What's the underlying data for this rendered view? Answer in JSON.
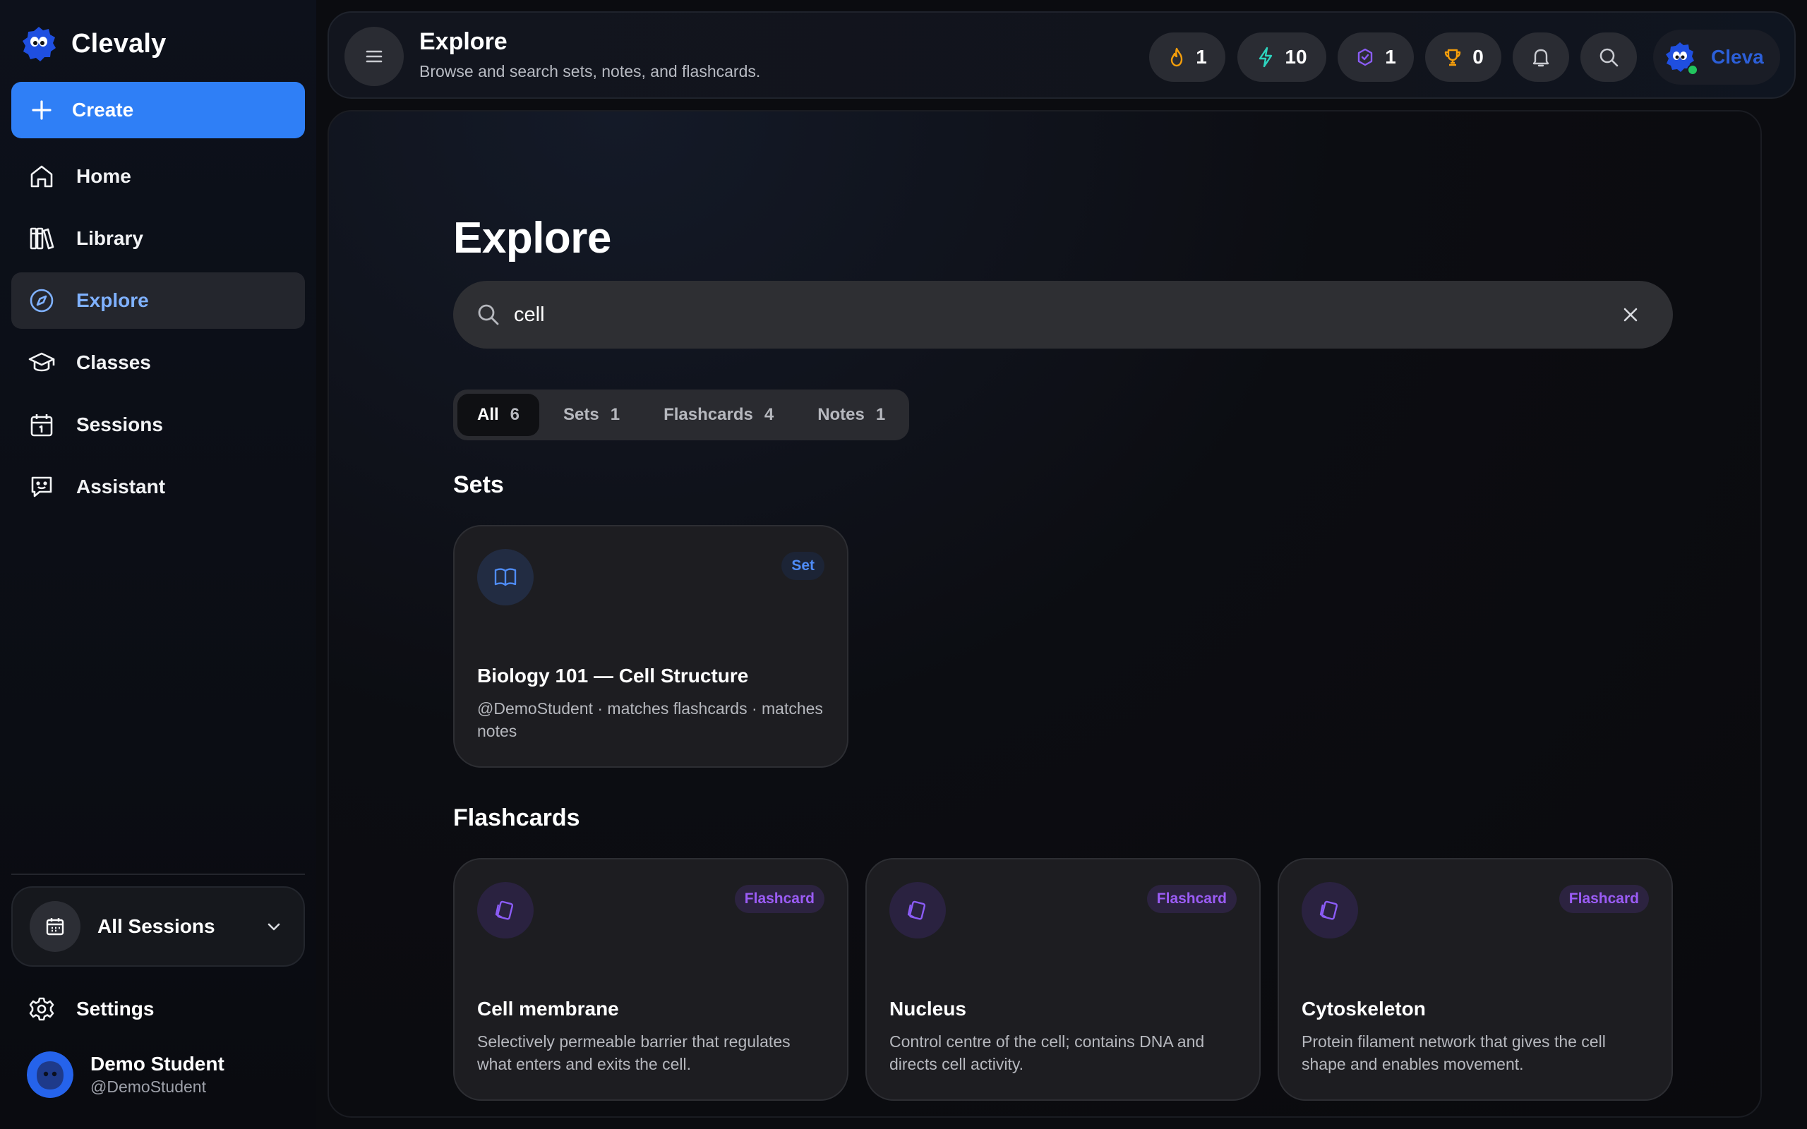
{
  "app": {
    "name": "Clevaly"
  },
  "sidebar": {
    "create_label": "Create",
    "items": [
      {
        "label": "Home",
        "icon": "home-icon"
      },
      {
        "label": "Library",
        "icon": "library-icon"
      },
      {
        "label": "Explore",
        "icon": "compass-icon",
        "active": true
      },
      {
        "label": "Classes",
        "icon": "graduation-cap-icon"
      },
      {
        "label": "Sessions",
        "icon": "calendar-icon"
      },
      {
        "label": "Assistant",
        "icon": "chat-bot-icon"
      }
    ],
    "sessions_select": "All Sessions",
    "settings_label": "Settings",
    "user": {
      "name": "Demo Student",
      "handle": "@DemoStudent"
    }
  },
  "topbar": {
    "title": "Explore",
    "subtitle": "Browse and search sets, notes, and flashcards.",
    "stats": {
      "streak": "1",
      "energy": "10",
      "badges": "1",
      "trophies": "0"
    },
    "profile_name": "Cleva"
  },
  "main": {
    "title": "Explore",
    "search": {
      "value": "cell"
    },
    "filters": [
      {
        "label": "All",
        "count": "6",
        "active": true
      },
      {
        "label": "Sets",
        "count": "1"
      },
      {
        "label": "Flashcards",
        "count": "4"
      },
      {
        "label": "Notes",
        "count": "1"
      }
    ],
    "sets_heading": "Sets",
    "sets": [
      {
        "badge": "Set",
        "title": "Biology 101 — Cell Structure",
        "desc": "@DemoStudent · matches flashcards · matches notes"
      }
    ],
    "flashcards_heading": "Flashcards",
    "flashcards": [
      {
        "badge": "Flashcard",
        "title": "Cell membrane",
        "desc": "Selectively permeable barrier that regulates what enters and exits the cell."
      },
      {
        "badge": "Flashcard",
        "title": "Nucleus",
        "desc": "Control centre of the cell; contains DNA and directs cell activity."
      },
      {
        "badge": "Flashcard",
        "title": "Cytoskeleton",
        "desc": "Protein filament network that gives the cell shape and enables movement."
      }
    ]
  },
  "colors": {
    "accent": "#2f7ff6",
    "active_nav": "#7fb1ff",
    "set_badge": "#4f8cf7",
    "flashcard_badge": "#9b5cf6"
  }
}
